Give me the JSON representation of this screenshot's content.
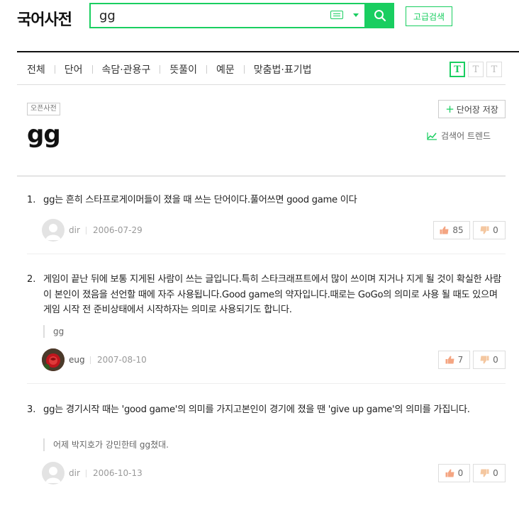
{
  "header": {
    "logo": "국어사전",
    "search_value": "gg",
    "advanced_search_label": "고급검색"
  },
  "tabs": [
    "전체",
    "단어",
    "속담·관용구",
    "뜻풀이",
    "예문",
    "맞춤법·표기법"
  ],
  "font_size_buttons": [
    "T",
    "T",
    "T"
  ],
  "word": {
    "source_tag": "오픈사전",
    "headword": "gg",
    "save_label": "단어장 저장",
    "trend_label": "검색어 트렌드"
  },
  "entries": [
    {
      "num": "1.",
      "definition": "gg는 흔히 스타프로게이머들이 졌을 때 쓰는 단어이다.풀어쓰면 good game 이다",
      "example": "",
      "author": "dir",
      "date": "2006-07-29",
      "likes": "85",
      "dislikes": "0"
    },
    {
      "num": "2.",
      "definition": "게임이 끝난 뒤에 보통 지게된 사람이 쓰는 글입니다.특히 스타크래프트에서 많이 쓰이며 지거나 지게 될 것이 확실한 사람이 본인이 졌음을 선언할 때에 자주 사용됩니다.Good game의 약자입니다.때로는 GoGo의 의미로 사용 될 때도 있으며 게임 시작 전 준비상태에서 시작하자는 의미로 사용되기도 합니다.",
      "example": "gg",
      "author": "eug",
      "date": "2007-08-10",
      "likes": "7",
      "dislikes": "0"
    },
    {
      "num": "3.",
      "definition": "gg는 경기시작 때는 'good game'의 의미를 가지고본인이 경기에 졌을 땐 'give up game'의 의미를 가집니다.",
      "example": "어제 박지호가 강민한테 gg쳤대.",
      "author": "dir",
      "date": "2006-10-13",
      "likes": "0",
      "dislikes": "0"
    }
  ],
  "colors": {
    "accent": "#19ce60"
  }
}
